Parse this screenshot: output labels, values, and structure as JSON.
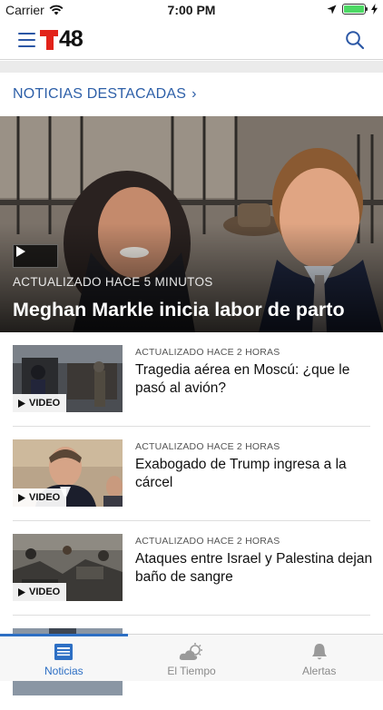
{
  "status_bar": {
    "carrier": "Carrier",
    "time": "7:00 PM",
    "battery_level": 1.0
  },
  "header": {
    "logo_text": "48",
    "logo_color": "#e2231a",
    "accent_color": "#2b57a5"
  },
  "section": {
    "title": "NOTICIAS DESTACADAS",
    "chevron": "›"
  },
  "hero": {
    "updated": "ACTUALIZADO HACE 5 MINUTOS",
    "headline": "Meghan Markle inicia labor de parto",
    "icon": "play-icon"
  },
  "articles": [
    {
      "updated": "ACTUALIZADO HACE 2 HORAS",
      "title": "Tragedia aérea en Moscú: ¿que le pasó al avión?",
      "video_label": "VIDEO"
    },
    {
      "updated": "ACTUALIZADO HACE 2 HORAS",
      "title": "Exabogado de Trump ingresa a la cárcel",
      "video_label": "VIDEO"
    },
    {
      "updated": "ACTUALIZADO HACE 2 HORAS",
      "title": "Ataques entre Israel y Palestina dejan baño de sangre",
      "video_label": "VIDEO"
    },
    {
      "updated": "",
      "title": "",
      "video_label": ""
    }
  ],
  "tabs": [
    {
      "label": "Noticias",
      "icon": "newspaper-icon",
      "active": true
    },
    {
      "label": "El Tiempo",
      "icon": "weather-icon",
      "active": false
    },
    {
      "label": "Alertas",
      "icon": "bell-icon",
      "active": false
    }
  ]
}
